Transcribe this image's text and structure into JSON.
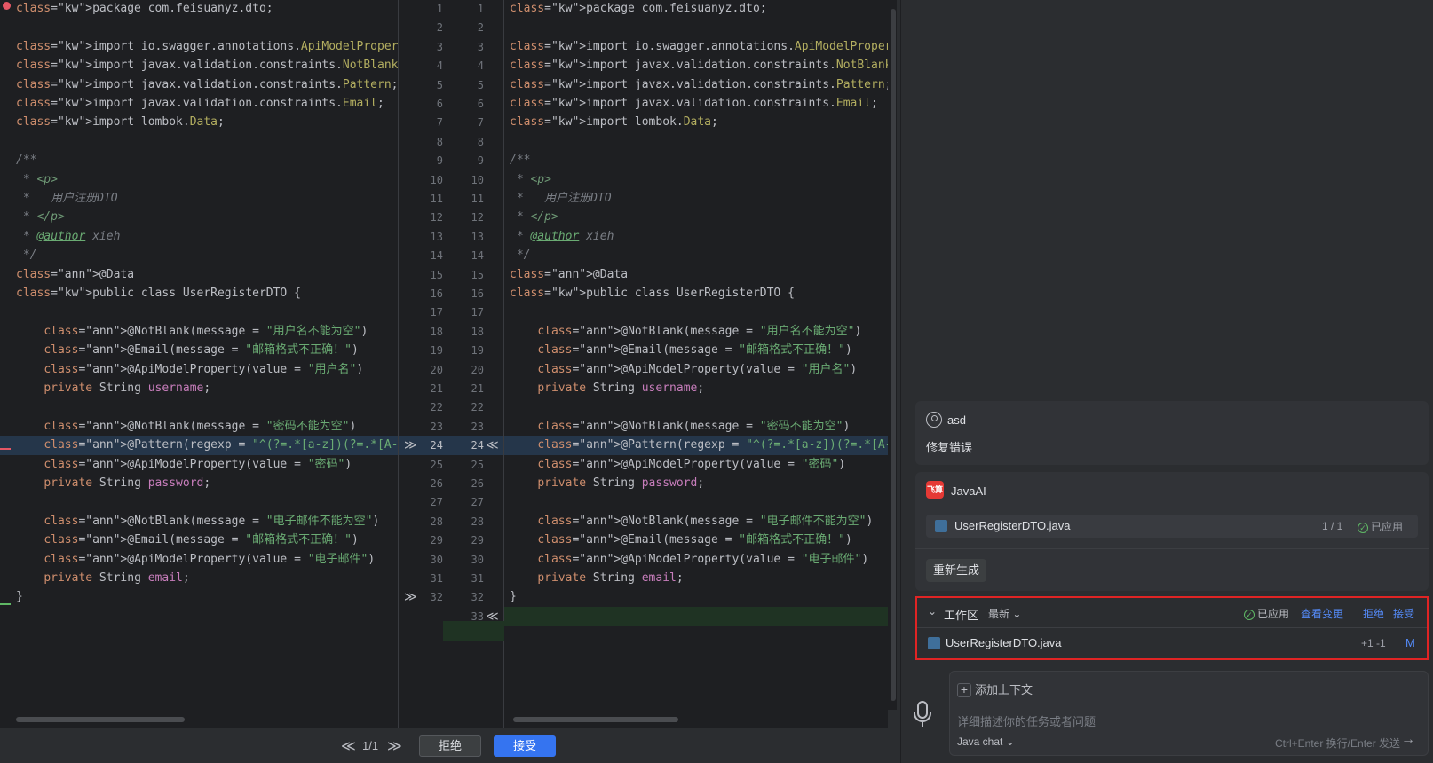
{
  "code_lines": [
    "package com.feisuanyz.dto;",
    "",
    "import io.swagger.annotations.ApiModelProperty;",
    "import javax.validation.constraints.NotBlank;",
    "import javax.validation.constraints.Pattern;",
    "import javax.validation.constraints.Email;",
    "import lombok.Data;",
    "",
    "/**",
    " * <p>",
    " *   用户注册DTO",
    " * </p>",
    " * @author xieh",
    " */",
    "@Data",
    "public class UserRegisterDTO {",
    "",
    "    @NotBlank(message = \"用户名不能为空\")",
    "    @Email(message = \"邮箱格式不正确！\")",
    "    @ApiModelProperty(value = \"用户名\")",
    "    private String username;",
    "",
    "    @NotBlank(message = \"密码不能为空\")",
    "    @Pattern(regexp = \"^(?=.*[a-z])(?=.*[A-Z])(?=.*\\d",
    "    @ApiModelProperty(value = \"密码\")",
    "    private String password;",
    "",
    "    @NotBlank(message = \"电子邮件不能为空\")",
    "    @Email(message = \"邮箱格式不正确！\")",
    "    @ApiModelProperty(value = \"电子邮件\")",
    "    private String email;",
    "}"
  ],
  "right_line24": "    @Pattern(regexp = \"^(?=.*[a-z])(?=.*[A-Z])(?=.*\\\\d)",
  "gutter": {
    "left_numbers": [
      "1",
      "2",
      "3",
      "4",
      "5",
      "6",
      "7",
      "8",
      "9",
      "10",
      "11",
      "12",
      "13",
      "14",
      "15",
      "16",
      "17",
      "18",
      "19",
      "20",
      "21",
      "22",
      "23",
      "24",
      "25",
      "26",
      "27",
      "28",
      "29",
      "30",
      "31",
      "32"
    ],
    "right_numbers": [
      "1",
      "2",
      "3",
      "4",
      "5",
      "6",
      "7",
      "8",
      "9",
      "10",
      "11",
      "12",
      "13",
      "14",
      "15",
      "16",
      "17",
      "18",
      "19",
      "20",
      "21",
      "22",
      "23",
      "24",
      "25",
      "26",
      "27",
      "28",
      "29",
      "30",
      "31",
      "32",
      "33"
    ],
    "arrow_left": "≫",
    "arrow_right": "≪"
  },
  "toolbar": {
    "prev": "≪",
    "count": "1/1",
    "next": "≫",
    "reject_label": "拒绝",
    "accept_label": "接受"
  },
  "chat": {
    "user": {
      "name": "asd",
      "message": "修复错误"
    },
    "ai": {
      "logo_text": "飞算",
      "name": "JavaAI",
      "file_name": "UserRegisterDTO.java",
      "file_count": "1 / 1",
      "applied_label": "已应用",
      "regenerate_label": "重新生成"
    }
  },
  "workspace": {
    "title": "工作区",
    "sort_label": "最新",
    "applied_label": "已应用",
    "view_changes": "查看变更",
    "reject": "拒绝",
    "accept": "接受",
    "file_name": "UserRegisterDTO.java",
    "diff": "+1 -1",
    "status": "M"
  },
  "input": {
    "add_context": "添加上下文",
    "placeholder": "详细描述你的任务或者问题",
    "model": "Java chat",
    "hint": "Ctrl+Enter 换行/Enter 发送",
    "send_icon": "→"
  },
  "colors": {
    "editor_bg": "#1e1f22",
    "panel_bg": "#2b2d30",
    "keyword": "#cf8e6d",
    "annotation": "#b3ae60",
    "string": "#6aab73",
    "accent": "#3574f0",
    "highlight_border": "#e02424"
  }
}
